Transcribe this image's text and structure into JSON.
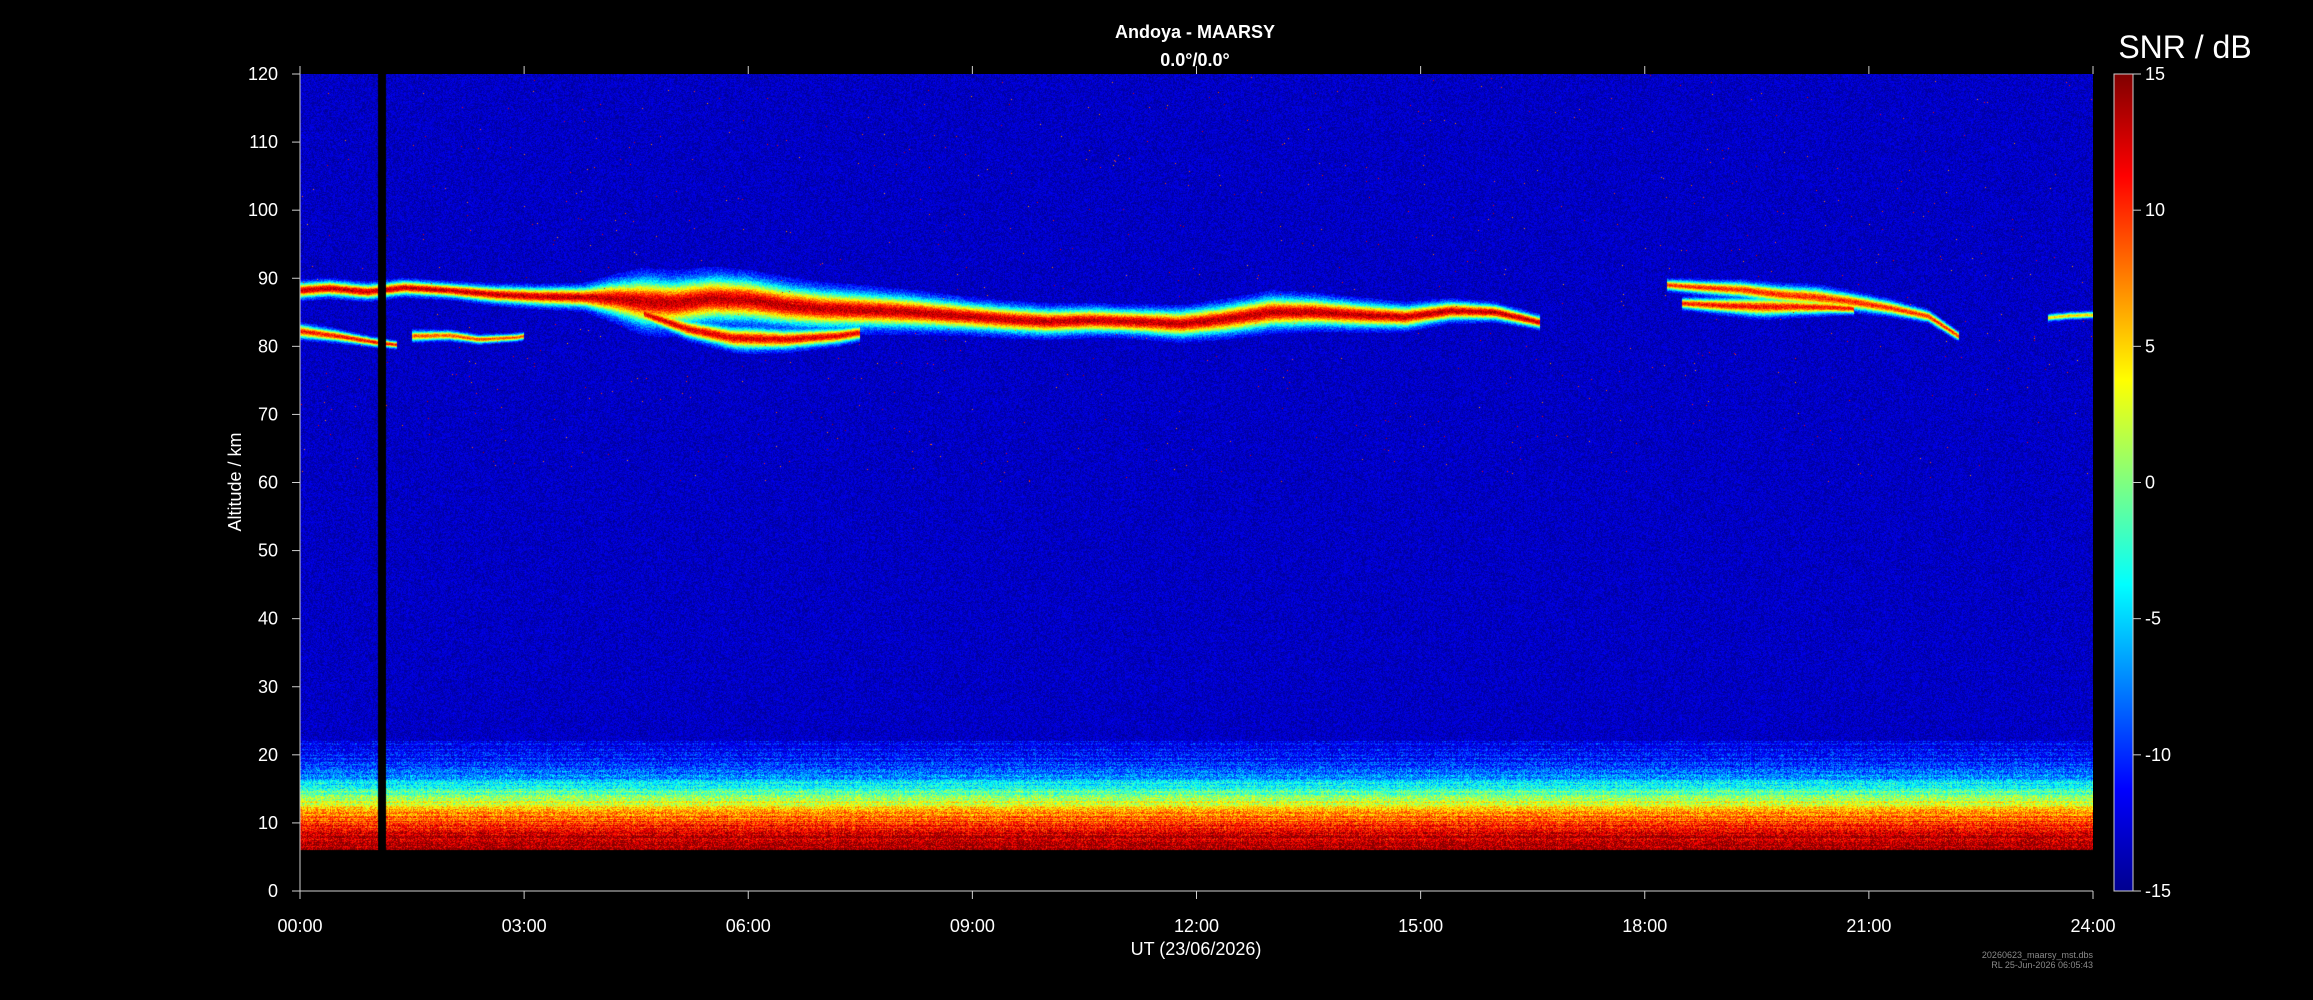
{
  "chart_data": {
    "type": "heatmap",
    "title": "Andoya - MAARSY",
    "subtitle": "0.0°/0.0°",
    "xlabel": "UT (23/06/2026)",
    "ylabel": "Altitude / km",
    "xlim": [
      "00:00",
      "24:00"
    ],
    "x_ticks": [
      "00:00",
      "03:00",
      "06:00",
      "09:00",
      "12:00",
      "15:00",
      "18:00",
      "21:00",
      "24:00"
    ],
    "ylim": [
      0,
      120
    ],
    "y_ticks": [
      "0",
      "10",
      "20",
      "30",
      "40",
      "50",
      "60",
      "70",
      "80",
      "90",
      "100",
      "110",
      "120"
    ],
    "colorbar": {
      "label": "SNR / dB",
      "range": [
        -15,
        15
      ],
      "ticks": [
        "15",
        "10",
        "5",
        "0",
        "-5",
        "-10",
        "-15"
      ],
      "colormap": "jet"
    },
    "background_snr_db": -13,
    "data_gap": {
      "start_hour": 1.05,
      "end_hour": 1.15
    },
    "lower_layer": {
      "bottom_km": 6,
      "profile": [
        {
          "altitude_km": 6,
          "snr_db": 14
        },
        {
          "altitude_km": 8,
          "snr_db": 13
        },
        {
          "altitude_km": 10,
          "snr_db": 10
        },
        {
          "altitude_km": 12,
          "snr_db": 5
        },
        {
          "altitude_km": 14,
          "snr_db": 0
        },
        {
          "altitude_km": 16,
          "snr_db": -5
        },
        {
          "altitude_km": 18,
          "snr_db": -9
        },
        {
          "altitude_km": 21,
          "snr_db": -12
        }
      ]
    },
    "pmse_echoes": [
      {
        "peak_snr_db": 10,
        "center": [
          [
            0.0,
            88.2
          ],
          [
            0.4,
            88.5
          ],
          [
            0.9,
            88.0
          ],
          [
            1.4,
            88.6
          ],
          [
            2.0,
            88.2
          ],
          [
            2.6,
            87.6
          ],
          [
            3.2,
            87.3
          ],
          [
            3.8,
            87.2
          ],
          [
            4.2,
            87.0
          ],
          [
            4.6,
            86.5
          ],
          [
            5.0,
            86.3
          ],
          [
            5.5,
            87.0
          ],
          [
            6.0,
            86.8
          ],
          [
            6.5,
            86.0
          ],
          [
            7.0,
            85.5
          ],
          [
            7.6,
            85.3
          ],
          [
            8.2,
            85.0
          ],
          [
            8.8,
            84.5
          ],
          [
            9.4,
            84.0
          ],
          [
            10.0,
            83.6
          ],
          [
            10.6,
            83.8
          ],
          [
            11.2,
            83.6
          ],
          [
            11.8,
            83.3
          ],
          [
            12.4,
            84.0
          ],
          [
            13.0,
            85.0
          ],
          [
            13.6,
            85.0
          ],
          [
            14.2,
            84.6
          ],
          [
            14.8,
            84.3
          ],
          [
            15.4,
            85.2
          ],
          [
            16.0,
            85.0
          ],
          [
            16.6,
            83.5
          ]
        ],
        "half_thickness_km": [
          [
            0.0,
            0.9
          ],
          [
            2.0,
            0.8
          ],
          [
            3.8,
            1.2
          ],
          [
            4.6,
            2.8
          ],
          [
            6.0,
            2.5
          ],
          [
            7.0,
            2.2
          ],
          [
            9.0,
            1.6
          ],
          [
            11.0,
            1.4
          ],
          [
            13.0,
            1.8
          ],
          [
            15.0,
            1.2
          ],
          [
            16.6,
            0.7
          ]
        ]
      },
      {
        "peak_snr_db": 9,
        "center": [
          [
            4.6,
            84.8
          ],
          [
            5.2,
            82.5
          ],
          [
            5.8,
            81.2
          ],
          [
            6.5,
            81.0
          ],
          [
            7.2,
            81.5
          ],
          [
            7.5,
            82.0
          ]
        ],
        "half_thickness_km": [
          [
            4.6,
            0.8
          ],
          [
            6.0,
            1.3
          ],
          [
            7.5,
            0.8
          ]
        ]
      },
      {
        "peak_snr_db": 8,
        "center": [
          [
            0.0,
            82.2
          ],
          [
            0.5,
            81.5
          ],
          [
            1.0,
            80.6
          ],
          [
            1.3,
            80.2
          ]
        ],
        "half_thickness_km": [
          [
            0.0,
            0.8
          ],
          [
            1.3,
            0.4
          ]
        ]
      },
      {
        "peak_snr_db": 6,
        "center": [
          [
            1.5,
            81.5
          ],
          [
            2.0,
            81.6
          ],
          [
            2.4,
            81.0
          ],
          [
            2.9,
            81.3
          ],
          [
            3.0,
            81.5
          ]
        ],
        "half_thickness_km": [
          [
            1.5,
            0.6
          ],
          [
            3.0,
            0.4
          ]
        ]
      },
      {
        "peak_snr_db": 7,
        "center": [
          [
            18.3,
            89.0
          ],
          [
            18.8,
            88.6
          ],
          [
            19.3,
            88.3
          ],
          [
            19.8,
            87.6
          ],
          [
            20.3,
            87.2
          ],
          [
            20.8,
            86.5
          ],
          [
            21.3,
            85.6
          ],
          [
            21.8,
            84.4
          ],
          [
            22.2,
            81.5
          ]
        ],
        "half_thickness_km": [
          [
            18.3,
            0.6
          ],
          [
            19.3,
            0.9
          ],
          [
            20.3,
            1.1
          ],
          [
            21.3,
            0.8
          ],
          [
            22.2,
            0.5
          ]
        ]
      },
      {
        "peak_snr_db": 8,
        "center": [
          [
            18.5,
            86.3
          ],
          [
            19.0,
            86.0
          ],
          [
            19.5,
            85.8
          ],
          [
            20.0,
            85.8
          ],
          [
            20.5,
            85.7
          ],
          [
            20.8,
            85.5
          ]
        ],
        "half_thickness_km": [
          [
            18.5,
            0.6
          ],
          [
            19.6,
            1.1
          ],
          [
            20.8,
            0.6
          ]
        ]
      },
      {
        "peak_snr_db": 2,
        "center": [
          [
            23.4,
            84.2
          ],
          [
            23.7,
            84.5
          ],
          [
            24.0,
            84.6
          ]
        ],
        "half_thickness_km": [
          [
            23.4,
            0.4
          ],
          [
            24.0,
            0.4
          ]
        ]
      }
    ]
  },
  "footer": {
    "file": "20260623_maarsy_mst.dbs",
    "stamp": "RL 25-Jun-2026 06:05:43"
  }
}
